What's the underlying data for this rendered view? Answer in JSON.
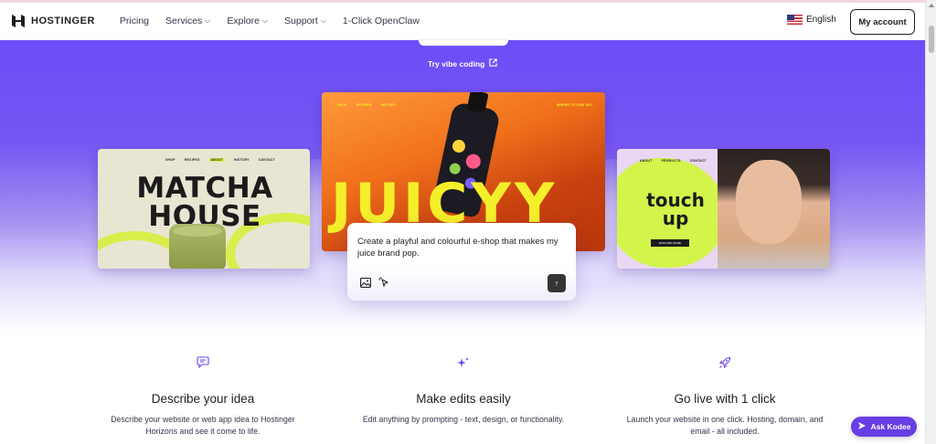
{
  "brand": {
    "name": "HOSTINGER",
    "accent": "#673de6",
    "hero_top": "#6c4df6"
  },
  "nav": {
    "items": [
      {
        "label": "Pricing",
        "has_dropdown": false
      },
      {
        "label": "Services",
        "has_dropdown": true
      },
      {
        "label": "Explore",
        "has_dropdown": true
      },
      {
        "label": "Support",
        "has_dropdown": true
      },
      {
        "label": "1-Click OpenClaw",
        "has_dropdown": false
      }
    ],
    "language": "English",
    "language_flag_icon": "us-flag-icon",
    "account_label": "My account"
  },
  "hero": {
    "vibe_link": "Try vibe coding",
    "vibe_icon": "external-link-icon"
  },
  "cards": {
    "matcha": {
      "nav": [
        "SHOP",
        "RECIPES",
        "ABOUT",
        "HISTORY",
        "CONTACT"
      ],
      "title_line1": "MATCHA",
      "title_line2": "HOUSE"
    },
    "juicy": {
      "nav": [
        "SHOP",
        "RECIPES",
        "HISTORY"
      ],
      "nav_right": "WHERE TO FIND US?",
      "title": "JUICYY"
    },
    "touch": {
      "nav": [
        "ABOUT",
        "PRODUCTS",
        "CONTACT"
      ],
      "title_line1": "touch",
      "title_line2": "up",
      "button": "EXPLORE MORE"
    }
  },
  "prompt": {
    "text": "Create a playful and colourful e-shop that makes my juice brand pop.",
    "image_icon": "image-icon",
    "cursor_icon": "pointer-click-icon",
    "send_icon": "arrow-up-icon"
  },
  "features": [
    {
      "icon": "chat-icon",
      "title": "Describe your idea",
      "desc": "Describe your website or web app idea to Hostinger Horizons and see it come to life."
    },
    {
      "icon": "sparkles-icon",
      "title": "Make edits easily",
      "desc": "Edit anything by prompting - text, design, or functionality."
    },
    {
      "icon": "rocket-icon",
      "title": "Go live with 1 click",
      "desc": "Launch your website in one click. Hosting, domain, and email - all included."
    }
  ],
  "ask_kodee": "Ask Kodee"
}
